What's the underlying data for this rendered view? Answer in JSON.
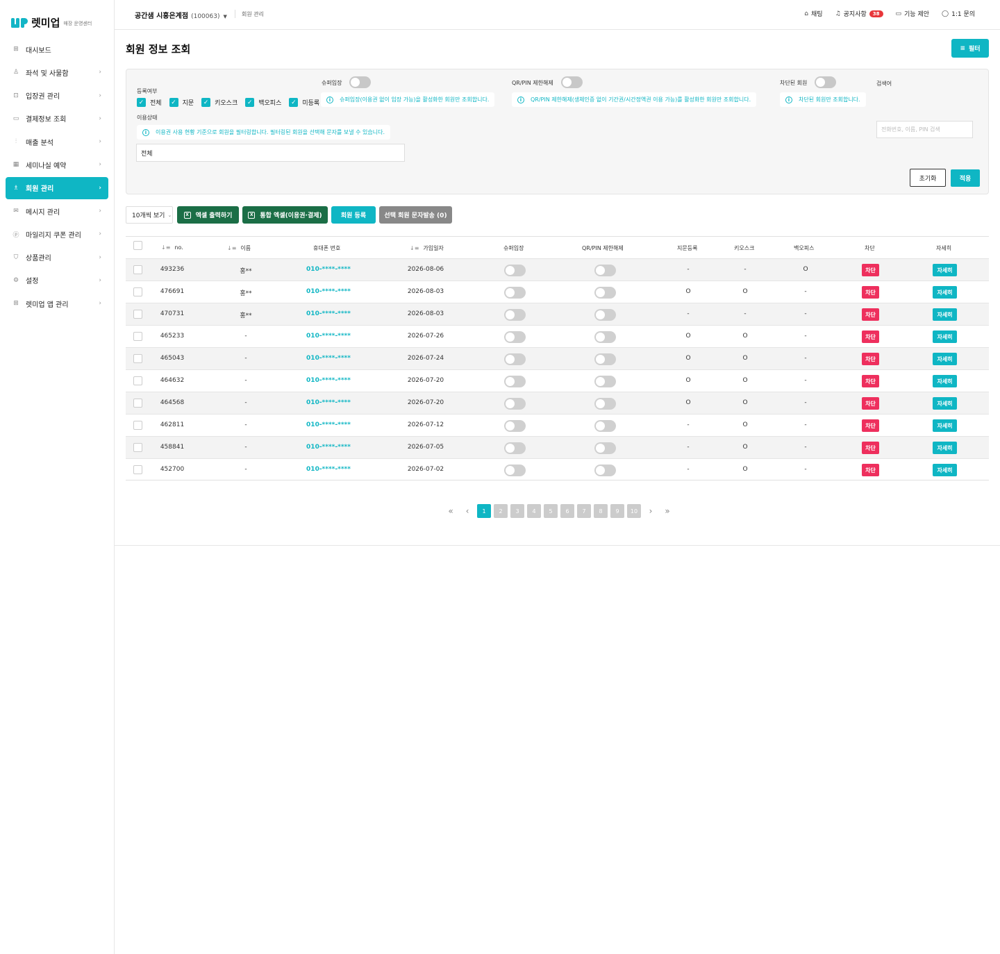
{
  "sidebar": {
    "logo_text": "렛미업",
    "logo_sub": "매장 운영센터",
    "items": [
      {
        "label": "대시보드",
        "icon": "grid-icon",
        "chevron": false
      },
      {
        "label": "좌석 및 사물함",
        "icon": "seat-icon",
        "chevron": true
      },
      {
        "label": "입장권 관리",
        "icon": "ticket-icon",
        "chevron": true
      },
      {
        "label": "결제정보 조회",
        "icon": "card-icon",
        "chevron": true
      },
      {
        "label": "매출 분석",
        "icon": "chart-icon",
        "chevron": true
      },
      {
        "label": "세미나실 예약",
        "icon": "calendar-icon",
        "chevron": true
      },
      {
        "label": "회원 관리",
        "icon": "users-icon",
        "chevron": true,
        "active": true
      },
      {
        "label": "메시지 관리",
        "icon": "mail-icon",
        "chevron": true
      },
      {
        "label": "마일리지 쿠폰 관리",
        "icon": "coin-icon",
        "chevron": true
      },
      {
        "label": "상품관리",
        "icon": "bag-icon",
        "chevron": true
      },
      {
        "label": "설정",
        "icon": "gear-icon",
        "chevron": true
      },
      {
        "label": "렛미업 앱 관리",
        "icon": "apps-icon",
        "chevron": true
      }
    ]
  },
  "header": {
    "store_name": "공간샘 시흥은계점",
    "store_code": "(100063)",
    "breadcrumb": "회원 관리",
    "links": {
      "chat": "채팅",
      "notice": "공지사항",
      "notice_count": "38",
      "suggest": "기능 제안",
      "inquiry": "1:1 문의"
    }
  },
  "page": {
    "title": "회원 정보 조회",
    "filter_button": "필터"
  },
  "filters": {
    "registration_label": "등록여부",
    "registration_options": [
      "전체",
      "지문",
      "키오스크",
      "백오피스",
      "미등록"
    ],
    "super_entry_label": "슈퍼입장",
    "super_entry_info": "슈퍼입장(이용권 없이 입장 가능)을 활성화한 회원만 조회합니다.",
    "qr_label": "QR/PIN 제한해제",
    "qr_info": "QR/PIN 제한해제(생체인증 없이 기간권/시간정액권 이용 가능)를 활성화한 회원만 조회합니다.",
    "blocked_label": "차단된 회원",
    "blocked_info": "차단된 회원만 조회합니다.",
    "search_label": "검색어",
    "search_placeholder": "전화번호, 이름, PIN 검색",
    "status_label": "이용상태",
    "status_info": "이용권 사용 현황 기준으로 회원을 필터링합니다. 필터링된 회원을 선택해 문자를 보낼 수 있습니다.",
    "status_value": "전체",
    "reset_button": "초기화",
    "apply_button": "적용"
  },
  "actions": {
    "page_size": "10개씩 보기",
    "excel_export": "엑셀 출력하기",
    "combined_excel": "통합 엑셀(이용권·결제)",
    "register_member": "회원 등록",
    "send_sms": "선택 회원 문자발송 (0)"
  },
  "table": {
    "headers": {
      "no": "no.",
      "name": "이름",
      "phone": "휴대폰 번호",
      "joined": "가입일자",
      "super_entry": "슈퍼입장",
      "qr": "QR/PIN 제한해제",
      "fingerprint": "지문등록",
      "kiosk": "키오스크",
      "backoffice": "백오피스",
      "block": "차단",
      "detail": "자세히"
    },
    "block_label": "차단",
    "detail_label": "자세히",
    "rows": [
      {
        "no": "493236",
        "name": "홍**",
        "phone": "010-****-****",
        "joined": "2026-08-06",
        "fingerprint": "-",
        "kiosk": "-",
        "backoffice": "O"
      },
      {
        "no": "476691",
        "name": "홍**",
        "phone": "010-****-****",
        "joined": "2026-08-03",
        "fingerprint": "O",
        "kiosk": "O",
        "backoffice": "-"
      },
      {
        "no": "470731",
        "name": "홍**",
        "phone": "010-****-****",
        "joined": "2026-08-03",
        "fingerprint": "-",
        "kiosk": "-",
        "backoffice": "-"
      },
      {
        "no": "465233",
        "name": "-",
        "phone": "010-****-****",
        "joined": "2026-07-26",
        "fingerprint": "O",
        "kiosk": "O",
        "backoffice": "-"
      },
      {
        "no": "465043",
        "name": "-",
        "phone": "010-****-****",
        "joined": "2026-07-24",
        "fingerprint": "O",
        "kiosk": "O",
        "backoffice": "-"
      },
      {
        "no": "464632",
        "name": "-",
        "phone": "010-****-****",
        "joined": "2026-07-20",
        "fingerprint": "O",
        "kiosk": "O",
        "backoffice": "-"
      },
      {
        "no": "464568",
        "name": "-",
        "phone": "010-****-****",
        "joined": "2026-07-20",
        "fingerprint": "O",
        "kiosk": "O",
        "backoffice": "-"
      },
      {
        "no": "462811",
        "name": "-",
        "phone": "010-****-****",
        "joined": "2026-07-12",
        "fingerprint": "-",
        "kiosk": "O",
        "backoffice": "-"
      },
      {
        "no": "458841",
        "name": "-",
        "phone": "010-****-****",
        "joined": "2026-07-05",
        "fingerprint": "-",
        "kiosk": "O",
        "backoffice": "-"
      },
      {
        "no": "452700",
        "name": "-",
        "phone": "010-****-****",
        "joined": "2026-07-02",
        "fingerprint": "-",
        "kiosk": "O",
        "backoffice": "-"
      }
    ]
  },
  "pagination": {
    "pages": [
      "1",
      "2",
      "3",
      "4",
      "5",
      "6",
      "7",
      "8",
      "9",
      "10"
    ],
    "current": "1"
  },
  "colors": {
    "accent": "#0fb6c4",
    "excel_green": "#1b6e46",
    "block_red": "#ee2f5d",
    "badge_red": "#e8363a"
  }
}
